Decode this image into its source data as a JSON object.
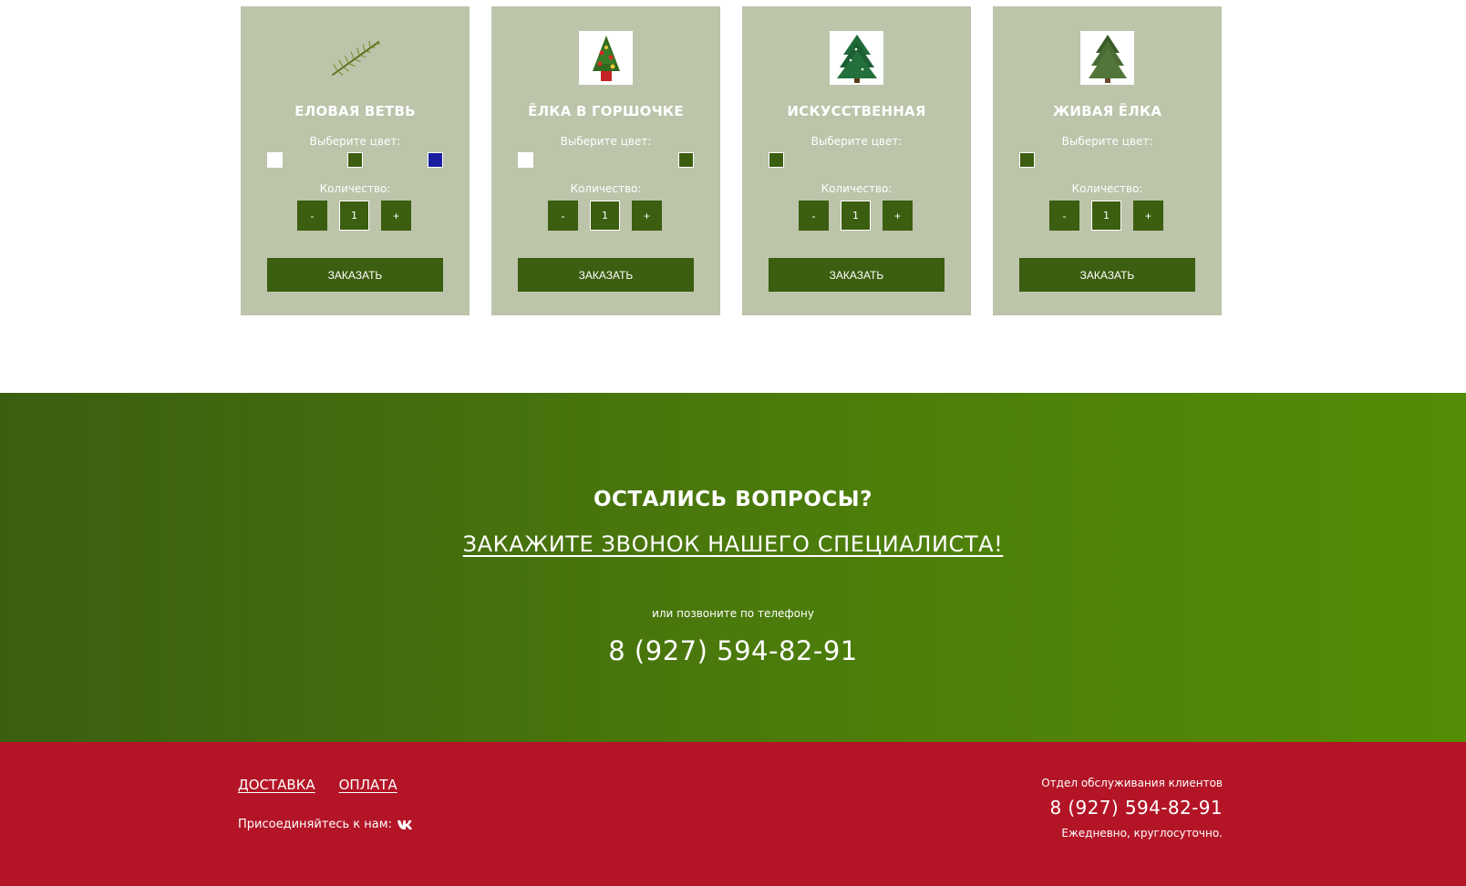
{
  "products": [
    {
      "title": "ЕЛОВАЯ ВЕТВЬ",
      "image_icon": "fir-branch-icon",
      "color_label": "Выберите цвет:",
      "colors": [
        "#ffffff",
        "#3c5e10",
        "#1a1fa0"
      ],
      "qty_label": "Количество:",
      "qty_minus": "-",
      "qty_value": "1",
      "qty_plus": "+",
      "order_label": "ЗАКАЗАТЬ"
    },
    {
      "title": "ЁЛКА В ГОРШОЧКЕ",
      "image_icon": "potted-tree-icon",
      "color_label": "Выберите цвет:",
      "colors": [
        "#ffffff",
        "#3c5e10"
      ],
      "qty_label": "Количество:",
      "qty_minus": "-",
      "qty_value": "1",
      "qty_plus": "+",
      "order_label": "ЗАКАЗАТЬ"
    },
    {
      "title": "ИСКУССТВЕННАЯ",
      "image_icon": "artificial-tree-icon",
      "color_label": "Выберите цвет:",
      "colors": [
        "#3c5e10"
      ],
      "qty_label": "Количество:",
      "qty_minus": "-",
      "qty_value": "1",
      "qty_plus": "+",
      "order_label": "ЗАКАЗАТЬ"
    },
    {
      "title": "ЖИВАЯ ЁЛКА",
      "image_icon": "live-tree-icon",
      "color_label": "Выберите цвет:",
      "colors": [
        "#3c5e10"
      ],
      "qty_label": "Количество:",
      "qty_minus": "-",
      "qty_value": "1",
      "qty_plus": "+",
      "order_label": "ЗАКАЗАТЬ"
    }
  ],
  "questions": {
    "title": "ОСТАЛИСЬ ВОПРОСЫ?",
    "callback_link": "ЗАКАЖИТЕ ЗВОНОК НАШЕГО СПЕЦИАЛИСТА!",
    "subtitle": "или позвоните по телефону",
    "phone": "8 (927) 594-82-91"
  },
  "footer": {
    "links": [
      "ДОСТАВКА",
      "ОПЛАТА"
    ],
    "join_text": "Присоединяйтесь к нам:",
    "social_icon": "vk-icon",
    "dept_label": "Отдел обслуживания клиентов",
    "phone": "8 (927) 594-82-91",
    "hours": "Ежедневно, круглосуточно."
  },
  "colors": {
    "card_bg": "#bcc4aa",
    "dark_green": "#3c5e10",
    "footer_red": "#b31527",
    "blue_swatch": "#1a1fa0"
  }
}
